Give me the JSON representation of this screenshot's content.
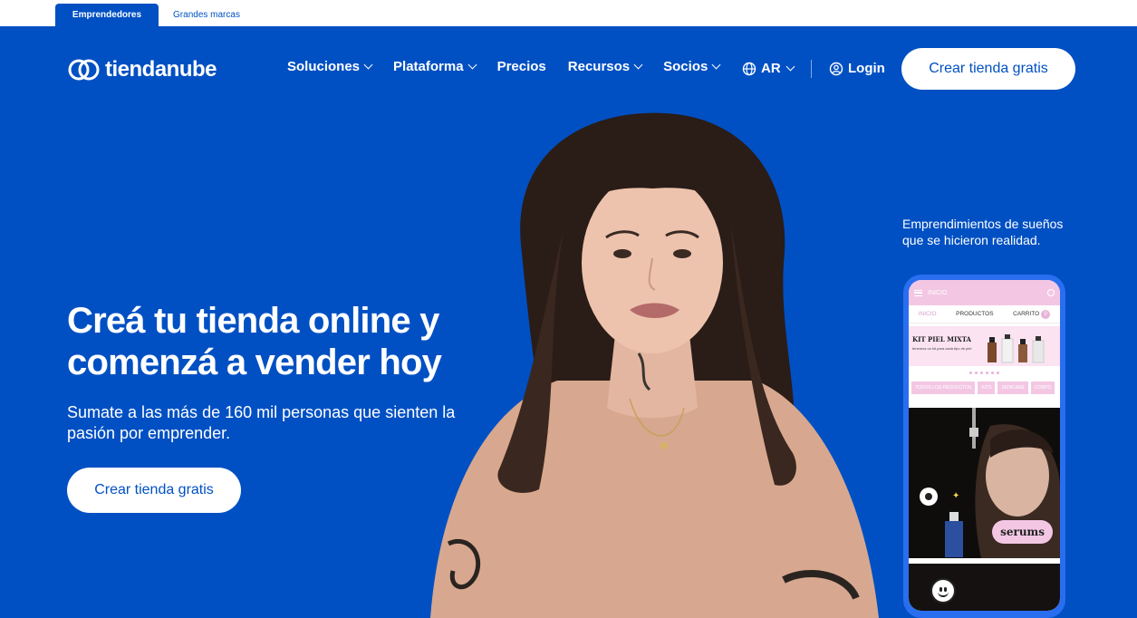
{
  "audience_tabs": [
    {
      "label": "Emprendedores",
      "active": true
    },
    {
      "label": "Grandes marcas",
      "active": false
    }
  ],
  "header": {
    "logo_text": "tiendanube",
    "logo_icon": "cloud-logo-icon",
    "nav": [
      {
        "label": "Soluciones",
        "dropdown": true
      },
      {
        "label": "Plataforma",
        "dropdown": true
      },
      {
        "label": "Precios",
        "dropdown": false
      },
      {
        "label": "Recursos",
        "dropdown": true
      },
      {
        "label": "Socios",
        "dropdown": true
      }
    ],
    "region": {
      "label": "AR",
      "icon": "globe-icon"
    },
    "login": {
      "label": "Login",
      "icon": "user-circle-icon"
    },
    "cta_label": "Crear tienda gratis"
  },
  "hero": {
    "title": "Creá tu tienda online y comenzá a vender hoy",
    "subtitle": "Sumate a las más de 160 mil personas que sienten la pasión por emprender.",
    "cta_label": "Crear tienda gratis"
  },
  "showcase": {
    "caption": "Emprendimientos de sueños que se hicieron realidad.",
    "phone": {
      "top_bar_label": "INICIO",
      "tabs": [
        "INICIO",
        "PRODUCTOS",
        "CARRITO"
      ],
      "cart_count": "0",
      "banner_title": "KIT PIEL MIXTA",
      "banner_subtitle": "tenemos un kit para cada tipo de piel",
      "chips": [
        "TODOS LOS PRODUCTOS",
        "KITS",
        "SKINCARE",
        "CORPO"
      ],
      "badge_label": "serums"
    }
  },
  "colors": {
    "brand_blue": "#0050c3",
    "white": "#ffffff",
    "phone_pink": "#f3c7e4",
    "skin_tone_shirt": "#d7a88f"
  }
}
